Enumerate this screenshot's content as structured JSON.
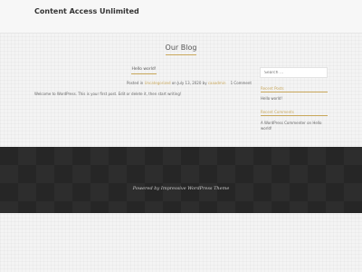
{
  "site": {
    "title": "Content Access Unlimited"
  },
  "page": {
    "title": "Our Blog"
  },
  "post": {
    "title": "Hello world!",
    "meta_posted_in": "Posted in",
    "category": "Uncategorized",
    "meta_on": "on",
    "date": "July 13, 2020",
    "meta_by": "by",
    "author": "caaadmin",
    "comments": "1 Comment",
    "excerpt": "Welcome to WordPress. This is your first post. Edit or delete it, then start writing!"
  },
  "sidebar": {
    "search_placeholder": "Search ...",
    "recent_posts_title": "Recent Posts",
    "recent_posts": [
      "Hello world!"
    ],
    "recent_comments_title": "Recent Comments",
    "recent_comments": [
      "A WordPress Commenter on Hello world!"
    ]
  },
  "footer": {
    "text": "Powered by Impressive WordPress Theme"
  },
  "colors": {
    "accent": "#c9a85c",
    "footer_bg": "#262626"
  }
}
